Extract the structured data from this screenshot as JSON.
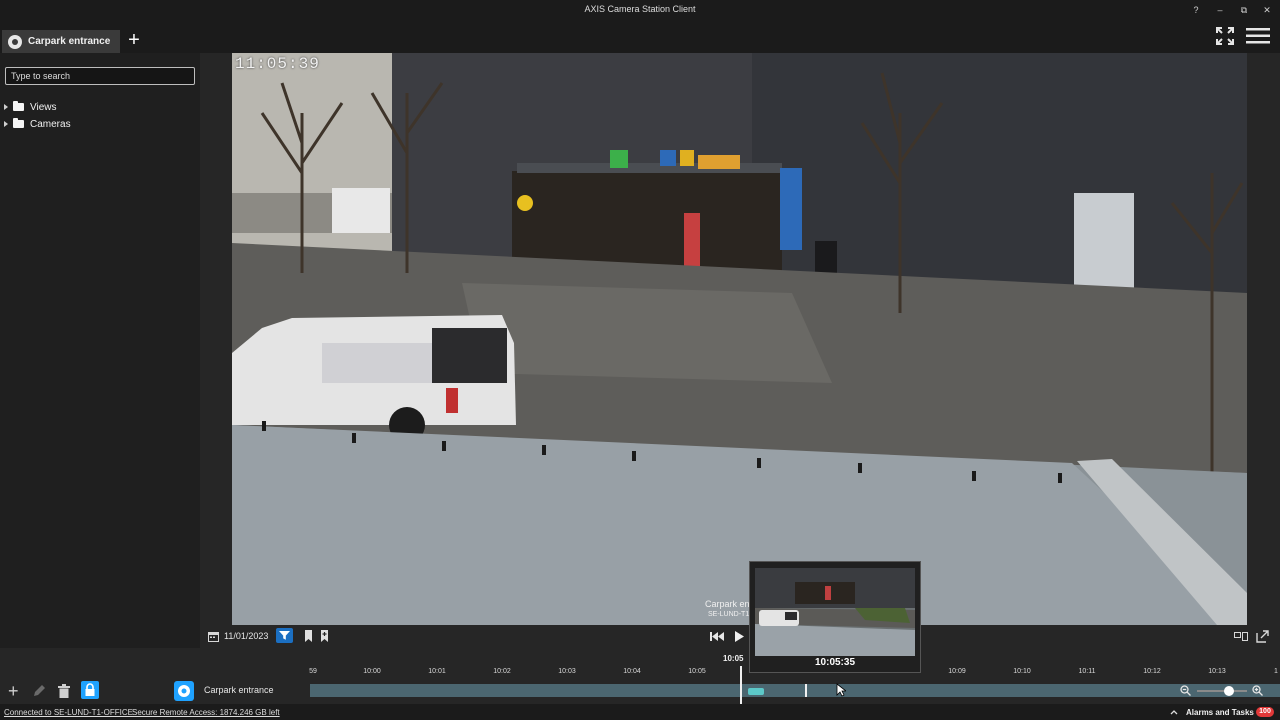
{
  "window": {
    "title": "AXIS Camera Station Client",
    "help": "?",
    "minimize": "–",
    "restore": "⧉",
    "close": "✕"
  },
  "tabs": [
    {
      "label": "Carpark entrance"
    }
  ],
  "sidebar": {
    "search_placeholder": "Type to search",
    "items": [
      {
        "label": "Views"
      },
      {
        "label": "Cameras"
      }
    ]
  },
  "video": {
    "overlay_time": "11:05:39",
    "overlay_label": "Carpark en",
    "overlay_sublabel": "SE-LUND-T1"
  },
  "controls": {
    "date": "11/01/2023"
  },
  "timeline": {
    "ticks": [
      "59",
      "10:00",
      "10:01",
      "10:02",
      "10:03",
      "10:04",
      "10:05",
      "10:09",
      "10:10",
      "10:11",
      "10:12",
      "10:13",
      "1"
    ],
    "playhead_time": "10:05",
    "thumbnail_time": "10:05:35",
    "camera_label": "Carpark entrance"
  },
  "status": {
    "connection": "Connected to SE-LUND-T1-OFFICE",
    "remote_access": "Secure Remote Access: 1874.246 GB left",
    "alarms_label": "Alarms and Tasks",
    "alarms_count": "100"
  },
  "colors": {
    "accent": "#1fa2ff",
    "record": "#5cc8c8",
    "track": "#4b6670",
    "alarm": "#e23838"
  }
}
